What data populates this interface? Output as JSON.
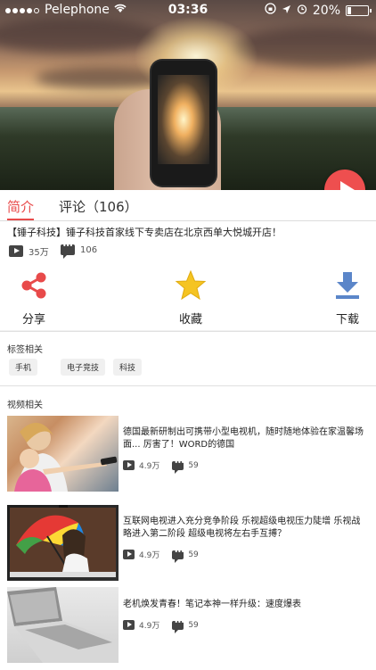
{
  "status_bar": {
    "carrier": "Pelephone",
    "time": "03:36",
    "battery": "20%"
  },
  "tabs": [
    {
      "label": "简介"
    },
    {
      "label": "评论（106）"
    }
  ],
  "video": {
    "title": "【锤子科技】锤子科技首家线下专卖店在北京西单大悦城开店！",
    "plays": "35万",
    "comments": "106"
  },
  "actions": [
    {
      "label": "分享",
      "icon": "share-icon",
      "color": "#e84a4a"
    },
    {
      "label": "收藏",
      "icon": "star-icon",
      "color": "#f5c422"
    },
    {
      "label": "下载",
      "icon": "download-icon",
      "color": "#5b86c9"
    }
  ],
  "tags_section": {
    "title": "标签相关",
    "tags": [
      "手机",
      "电子竞技",
      "科技"
    ]
  },
  "related_section": {
    "title": "视频相关",
    "items": [
      {
        "title": "德国最新研制出可携带小型电视机，随时随地体验在家温馨场面... 厉害了！WORD的德国",
        "plays": "4.9万",
        "comments": "59"
      },
      {
        "title": "互联网电视进入充分竞争阶段 乐视超级电视压力陡增  乐视战略进入第二阶段 超级电视将左右手互搏？",
        "plays": "4.9万",
        "comments": "59"
      },
      {
        "title": "老机焕发青春！笔记本神一样升级：速度爆表",
        "plays": "4.9万",
        "comments": "59"
      }
    ]
  },
  "colors": {
    "accent": "#e84a4a"
  }
}
